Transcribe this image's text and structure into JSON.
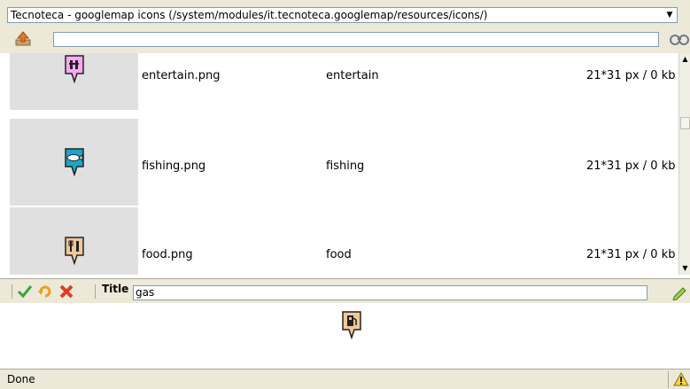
{
  "folder_select": {
    "value": "Tecnoteca - googlemap icons (/system/modules/it.tecnoteca.googlemap/resources/icons/)"
  },
  "search": {
    "value": ""
  },
  "icons": [
    {
      "file": "entertain.png",
      "title": "entertain",
      "size": "21*31 px / 0 kb",
      "color": "#f7a8f0"
    },
    {
      "file": "fishing.png",
      "title": "fishing",
      "size": "21*31 px / 0 kb",
      "color": "#1aa6c8"
    },
    {
      "file": "food.png",
      "title": "food",
      "size": "21*31 px / 0 kb",
      "color": "#f2c79a"
    }
  ],
  "editor": {
    "title_label": "Title",
    "title_value": "gas",
    "preview_color": "#f2c79a"
  },
  "status": {
    "text": "Done"
  }
}
